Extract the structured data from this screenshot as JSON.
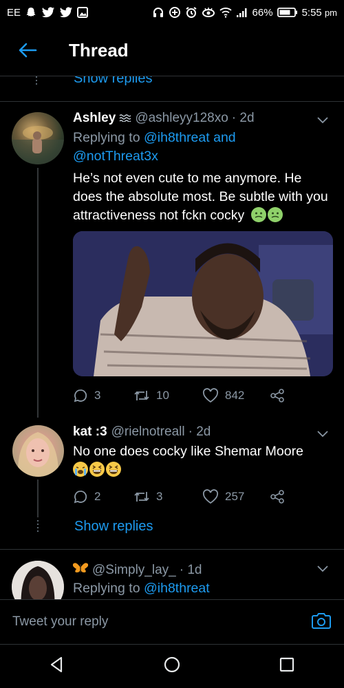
{
  "status_bar": {
    "carrier": "EE",
    "battery": "66%",
    "time": "5:55",
    "time_suffix": "pm"
  },
  "header": {
    "title": "Thread"
  },
  "top_show_replies": "Show replies",
  "tweets": [
    {
      "name": "Ashley",
      "handle": "@ashleyy128xo",
      "time": "· 2d",
      "replying_prefix": "Replying to",
      "replying_to_1": "@ih8threat",
      "replying_and": "and",
      "replying_to_2": "@notThreat3x",
      "text": "He’s not even cute to me anymore. He does the absolute most. Be subtle with you attractiveness not fckn cocky",
      "emojis": [
        "nauseated-face",
        "nauseated-face"
      ],
      "replies": "3",
      "retweets": "10",
      "likes": "842"
    },
    {
      "name": "kat :3",
      "handle": "@rielnotreall",
      "time": "· 2d",
      "text": "No one does cocky like Shemar Moore",
      "emojis": [
        "loudly-crying-face",
        "grinning-squinting-face",
        "grinning-squinting-face"
      ],
      "replies": "2",
      "retweets": "3",
      "likes": "257",
      "show_replies": "Show replies"
    },
    {
      "handle": "@Simply_lay_",
      "time": "· 1d",
      "replying_prefix": "Replying to",
      "replying_to_1": "@ih8threat"
    }
  ],
  "composer": {
    "placeholder": "Tweet your reply"
  },
  "colors": {
    "background": "#000000",
    "accent": "#1d9bf0",
    "muted": "#8b98a5",
    "text": "#e7e9ea"
  }
}
